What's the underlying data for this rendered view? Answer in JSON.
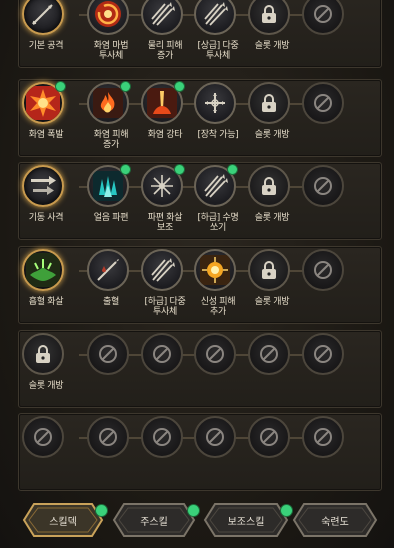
{
  "rows": [
    {
      "slots": [
        {
          "label": "기본 공격",
          "icon": "arrow-shot-icon",
          "state": "head"
        },
        {
          "label": "화염 마법\n투사체",
          "icon": "fire-swirl-icon",
          "state": "skill"
        },
        {
          "label": "물리 피해\n증가",
          "icon": "crossed-arrows-icon",
          "state": "skill"
        },
        {
          "label": "[상급] 다중\n투사체",
          "icon": "multi-arrow-icon",
          "state": "skill"
        },
        {
          "label": "슬롯 개방",
          "icon": "lock-icon",
          "state": "lock"
        },
        {
          "label": "",
          "icon": "disabled-icon",
          "state": "dis"
        }
      ]
    },
    {
      "slots": [
        {
          "label": "화염 폭발",
          "icon": "fire-explosion-icon",
          "state": "head",
          "dot": true
        },
        {
          "label": "화염 피해\n증가",
          "icon": "fire-burst-icon",
          "state": "skill",
          "dot": true
        },
        {
          "label": "화염 강타",
          "icon": "fire-strike-icon",
          "state": "skill",
          "dot": true
        },
        {
          "label": "[장착 가능]",
          "icon": "crosshair-plus-icon",
          "state": "empty"
        },
        {
          "label": "슬롯 개방",
          "icon": "lock-icon",
          "state": "lock"
        },
        {
          "label": "",
          "icon": "disabled-icon",
          "state": "dis"
        }
      ]
    },
    {
      "slots": [
        {
          "label": "기동 사격",
          "icon": "dash-arrows-icon",
          "state": "head"
        },
        {
          "label": "얼음 파편",
          "icon": "ice-shard-icon",
          "state": "skill",
          "dot": true
        },
        {
          "label": "파편 화살\n보조",
          "icon": "shatter-arrow-icon",
          "state": "skill",
          "dot": true
        },
        {
          "label": "[하급] 수명\n쏘기",
          "icon": "arrow-volley-icon",
          "state": "skill",
          "dot": true
        },
        {
          "label": "슬롯 개방",
          "icon": "lock-icon",
          "state": "lock"
        },
        {
          "label": "",
          "icon": "disabled-icon",
          "state": "dis"
        }
      ]
    },
    {
      "slots": [
        {
          "label": "흡혈 화살",
          "icon": "vampiric-arrow-icon",
          "state": "head"
        },
        {
          "label": "출혈",
          "icon": "bleed-icon",
          "state": "skill"
        },
        {
          "label": "[하급] 다중\n투사체",
          "icon": "multi-arrow-icon",
          "state": "skill"
        },
        {
          "label": "신성 피해\n추가",
          "icon": "holy-burst-icon",
          "state": "skill"
        },
        {
          "label": "슬롯 개방",
          "icon": "lock-icon",
          "state": "lock"
        },
        {
          "label": "",
          "icon": "disabled-icon",
          "state": "dis"
        }
      ]
    },
    {
      "slots": [
        {
          "label": "슬롯 개방",
          "icon": "lock-icon",
          "state": "lock"
        },
        {
          "label": "",
          "icon": "disabled-icon",
          "state": "dis"
        },
        {
          "label": "",
          "icon": "disabled-icon",
          "state": "dis"
        },
        {
          "label": "",
          "icon": "disabled-icon",
          "state": "dis"
        },
        {
          "label": "",
          "icon": "disabled-icon",
          "state": "dis"
        },
        {
          "label": "",
          "icon": "disabled-icon",
          "state": "dis"
        }
      ]
    },
    {
      "slots": [
        {
          "label": "",
          "icon": "disabled-icon",
          "state": "dis"
        },
        {
          "label": "",
          "icon": "disabled-icon",
          "state": "dis"
        },
        {
          "label": "",
          "icon": "disabled-icon",
          "state": "dis"
        },
        {
          "label": "",
          "icon": "disabled-icon",
          "state": "dis"
        },
        {
          "label": "",
          "icon": "disabled-icon",
          "state": "dis"
        },
        {
          "label": "",
          "icon": "disabled-icon",
          "state": "dis"
        }
      ]
    }
  ],
  "tabs": [
    {
      "label": "스킬덱",
      "active": true,
      "dot": true
    },
    {
      "label": "주스킬",
      "active": false,
      "dot": true
    },
    {
      "label": "보조스킬",
      "active": false,
      "dot": true
    },
    {
      "label": "숙련도",
      "active": false,
      "dot": false
    }
  ],
  "colors": {
    "accent": "#c89a4e",
    "notify": "#3ad17a",
    "text": "#e6ddc9"
  }
}
